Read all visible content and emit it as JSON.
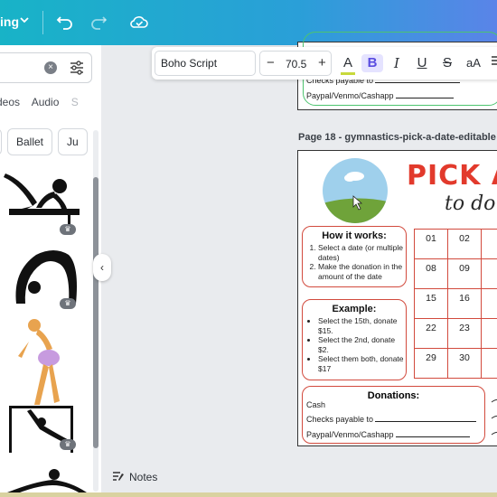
{
  "toolbar": {
    "label": "ing",
    "colors": {
      "gradient_start": "#18b3c7",
      "gradient_end": "#5a84e8"
    },
    "icons": [
      "chevron-down-icon",
      "undo-icon",
      "redo-icon",
      "cloud-check-icon"
    ]
  },
  "sidepanel": {
    "search_clear": "×",
    "categories": [
      "deos",
      "Audio",
      "S"
    ],
    "chips": [
      "Ballet",
      "Ju"
    ],
    "collapse_glyph": "‹"
  },
  "text_toolbar": {
    "font": "Boho Script",
    "size_minus": "−",
    "size": "70.5",
    "size_plus": "+",
    "color_glyph": "A",
    "bold": "B",
    "italic": "I",
    "underline": "U",
    "strike": "S",
    "case": "aA",
    "colors": {
      "underline_bar": "#c8d93c",
      "active_bg": "#e5e3ff"
    }
  },
  "page17": {
    "checks": "Checks payable to",
    "paypal": "Paypal/Venmo/Cashapp"
  },
  "page18": {
    "title": "Page 18 - gymnastics-pick-a-date-editable",
    "heading": "PICK A",
    "subheading": "to do",
    "how_it_works": {
      "title": "How it works:",
      "steps": [
        "Select a date (or multiple dates)",
        "Make the donation in the amount of the date"
      ]
    },
    "example": {
      "title": "Example:",
      "items": [
        "Select the 15th, donate $15.",
        "Select the 2nd, donate $2.",
        "Select them both, donate $17"
      ]
    },
    "grid": [
      "01",
      "02",
      "08",
      "09",
      "15",
      "16",
      "22",
      "23",
      "29",
      "30"
    ],
    "donations": {
      "title": "Donations:",
      "cash": "Cash",
      "checks": "Checks payable to",
      "paypal": "Paypal/Venmo/Cashapp"
    },
    "colors": {
      "accent_red": "#e23a2c",
      "border_red": "#d24a3d"
    }
  },
  "notes_label": "Notes"
}
